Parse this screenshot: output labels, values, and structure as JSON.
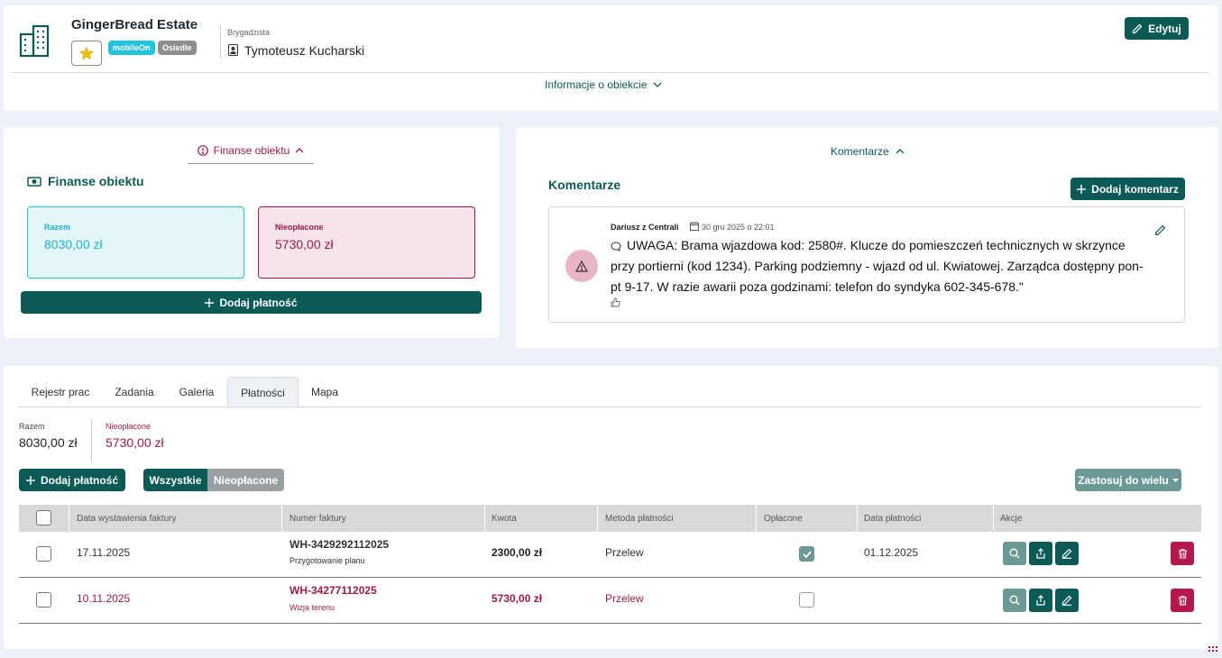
{
  "header": {
    "title": "GingerBread Estate",
    "badge_mobile": "mobileOn",
    "badge_type": "Osiedle",
    "foreman_label": "Brygadzista",
    "foreman_name": "Tymoteusz Kucharski",
    "edit_label": "Edytuj",
    "info_toggle": "Informacje o obiekcie"
  },
  "finance": {
    "toggle": "Finanse obiektu",
    "heading": "Finanse obiektu",
    "total_label": "Razem",
    "total_value": "8030,00 zł",
    "unpaid_label": "Nieopłacone",
    "unpaid_value": "5730,00 zł",
    "add_payment": "Dodaj płatność"
  },
  "comments": {
    "toggle": "Komentarze",
    "heading": "Komentarze",
    "add_comment": "Dodaj komentarz",
    "items": [
      {
        "author": "Dariusz z Centrali",
        "date": "30 gru 2025 o 22:01",
        "text": "UWAGA: Brama wjazdowa kod: 2580#. Klucze do pomieszczeń technicznych w skrzynce przy portierni (kod 1234). Parking podziemny - wjazd od ul. Kwiatowej. Zarządca dostępny pon-pt 9-17. W razie awarii poza godzinami: telefon do syndyka 602-345-678.\""
      }
    ]
  },
  "tabs": [
    "Rejestr prac",
    "Zadania",
    "Galeria",
    "Płatności",
    "Mapa"
  ],
  "payments": {
    "total_label": "Razem",
    "total_value": "8030,00 zł",
    "unpaid_label": "Nieopłacone",
    "unpaid_value": "5730,00 zł",
    "add_payment": "Dodaj płatność",
    "filter_all": "Wszystkie",
    "filter_unpaid": "Nieopłacone",
    "bulk": "Zastosuj do wielu",
    "columns": [
      "Data wystawienia faktury",
      "Numer faktury",
      "Kwota",
      "Metoda płatności",
      "Opłacone",
      "Data płatności",
      "Akcje"
    ],
    "rows": [
      {
        "issue_date": "17.11.2025",
        "number": "WH-3429292112025",
        "desc": "Przygotowanie planu",
        "amount": "2300,00 zł",
        "method": "Przelew",
        "paid": true,
        "paid_date": "01.12.2025"
      },
      {
        "issue_date": "10.11.2025",
        "number": "WH-34277112025",
        "desc": "Wizja terenu",
        "amount": "5730,00 zł",
        "method": "Przelew",
        "paid": false,
        "paid_date": ""
      }
    ]
  },
  "colors": {
    "primary": "#0b5a55",
    "accent_cyan": "#22c4e0",
    "unpaid": "#9b1b4c",
    "danger": "#b5174f"
  }
}
